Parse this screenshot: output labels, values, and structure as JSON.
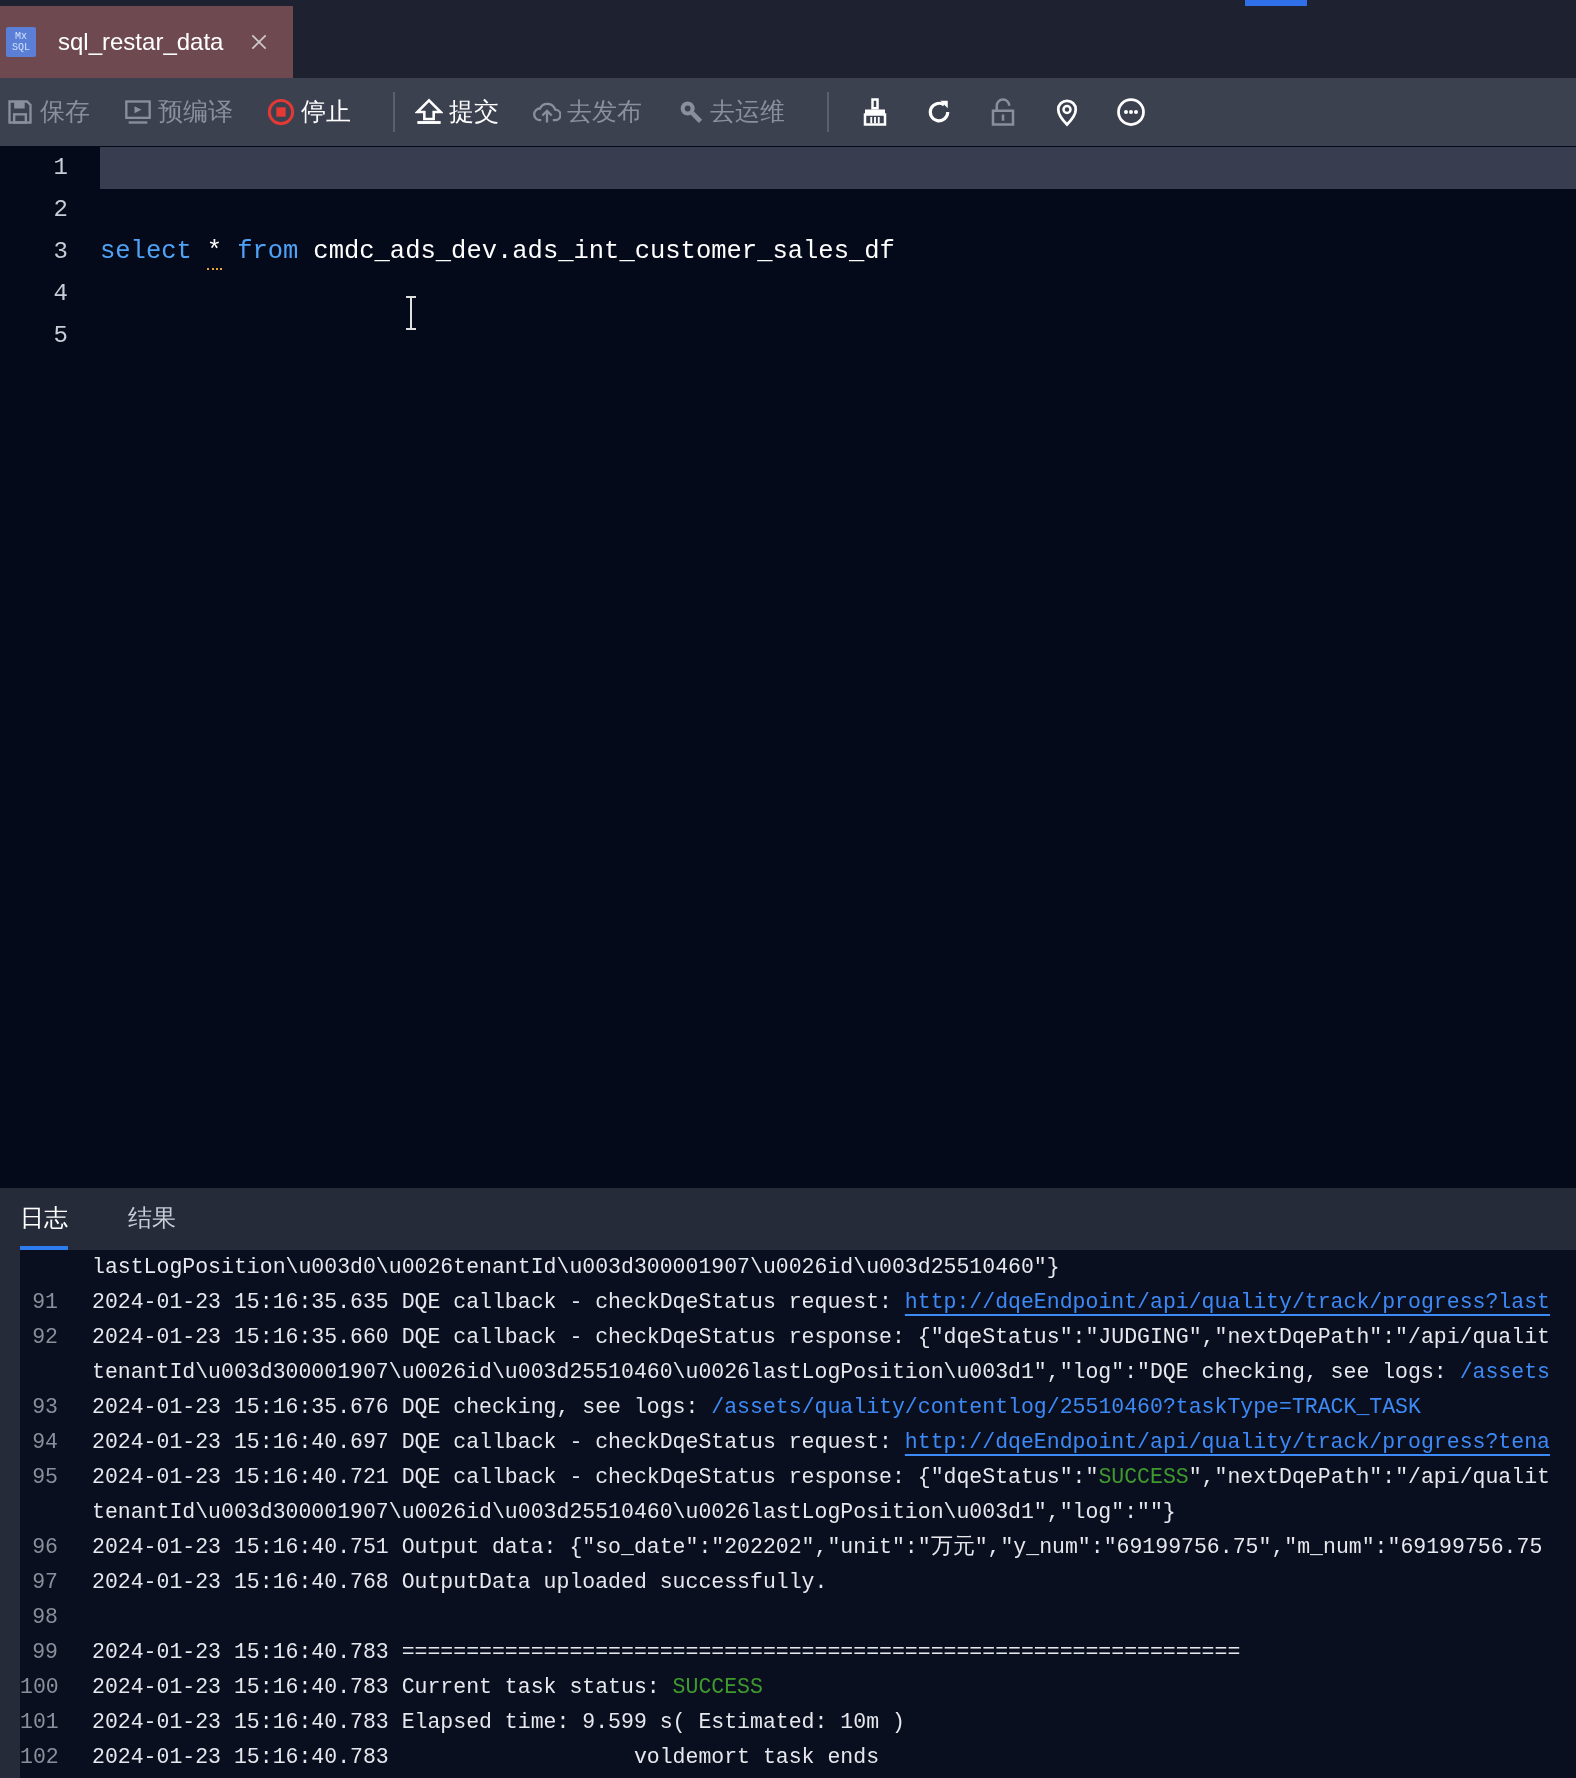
{
  "tab": {
    "icon_text": [
      "Mx",
      "SQL"
    ],
    "title": "sql_restar_data",
    "selected": true
  },
  "toolbar": [
    {
      "kind": "button",
      "label": "保存",
      "disabled": true
    },
    {
      "kind": "button",
      "label": "预编译",
      "disabled": true
    },
    {
      "kind": "button",
      "label": "停止",
      "disabled": false
    },
    {
      "kind": "separator"
    },
    {
      "kind": "button",
      "label": "提交",
      "disabled": false
    },
    {
      "kind": "button",
      "label": "去发布",
      "disabled": true
    },
    {
      "kind": "button",
      "label": "去运维",
      "disabled": true
    },
    {
      "kind": "separator"
    },
    {
      "kind": "icon",
      "disabled": false
    },
    {
      "kind": "icon",
      "disabled": false
    },
    {
      "kind": "icon",
      "disabled": true
    },
    {
      "kind": "icon",
      "disabled": false
    },
    {
      "kind": "icon",
      "disabled": false
    }
  ],
  "editor": {
    "lines": [
      {
        "number": "1",
        "current": true
      },
      {
        "number": "2",
        "current": false
      },
      {
        "number": "3",
        "current": false,
        "tokens": [
          {
            "kind": "keyword",
            "text": "select"
          },
          {
            "kind": "warning",
            "text": "*"
          },
          {
            "kind": "keyword",
            "text": "from"
          },
          {
            "kind": "plain",
            "text": "cmdc_ads_dev.ads_int_customer_sales_df"
          }
        ]
      },
      {
        "number": "4",
        "current": false
      },
      {
        "number": "5",
        "current": false
      }
    ]
  },
  "bottom_tabs": [
    {
      "label": "日志",
      "selected": true
    },
    {
      "label": "结果",
      "selected": false
    }
  ],
  "log": [
    {
      "segments": [
        {
          "kind": "text",
          "text": "lastLogPosition\\u003d0\\u0026tenantId\\u003d300001907\\u0026id\\u003d25510460\"}"
        }
      ]
    },
    {
      "number": "91",
      "segments": [
        {
          "kind": "text",
          "text": "2024-01-23 15:16:35.635 DQE callback - checkDqeStatus request: "
        },
        {
          "kind": "link",
          "text": "http://dqeEndpoint/api/quality/track/progress?last"
        }
      ]
    },
    {
      "number": "92",
      "segments": [
        {
          "kind": "text",
          "text": "2024-01-23 15:16:35.660 DQE callback - checkDqeStatus response: {\"dqeStatus\":\"JUDGING\",\"nextDqePath\":\"/api/qualit"
        }
      ]
    },
    {
      "segments": [
        {
          "kind": "text",
          "text": "tenantId\\u003d300001907\\u0026id\\u003d25510460\\u0026lastLogPosition\\u003d1\",\"log\":\"DQE checking, see logs: "
        },
        {
          "kind": "path",
          "text": "/assets"
        }
      ]
    },
    {
      "number": "93",
      "segments": [
        {
          "kind": "text",
          "text": "2024-01-23 15:16:35.676 DQE checking, see logs: "
        },
        {
          "kind": "path",
          "text": "/assets/quality/contentlog/25510460?taskType=TRACK_TASK"
        }
      ]
    },
    {
      "number": "94",
      "segments": [
        {
          "kind": "text",
          "text": "2024-01-23 15:16:40.697 DQE callback - checkDqeStatus request: "
        },
        {
          "kind": "link",
          "text": "http://dqeEndpoint/api/quality/track/progress?tena"
        }
      ]
    },
    {
      "number": "95",
      "segments": [
        {
          "kind": "text",
          "text": "2024-01-23 15:16:40.721 DQE callback - checkDqeStatus response: {\"dqeStatus\":\""
        },
        {
          "kind": "success",
          "text": "SUCCESS"
        },
        {
          "kind": "text",
          "text": "\",\"nextDqePath\":\"/api/qualit"
        }
      ]
    },
    {
      "segments": [
        {
          "kind": "text",
          "text": "tenantId\\u003d300001907\\u0026id\\u003d25510460\\u0026lastLogPosition\\u003d1\",\"log\":\"\"}"
        }
      ]
    },
    {
      "number": "96",
      "segments": [
        {
          "kind": "text",
          "text": "2024-01-23 15:16:40.751 Output data: {\"so_date\":\"202202\",\"unit\":\"万元\",\"y_num\":\"69199756.75\",\"m_num\":\"69199756.75"
        }
      ]
    },
    {
      "number": "97",
      "segments": [
        {
          "kind": "text",
          "text": "2024-01-23 15:16:40.768 OutputData uploaded successfully."
        }
      ]
    },
    {
      "number": "98"
    },
    {
      "number": "99",
      "segments": [
        {
          "kind": "text",
          "text": "2024-01-23 15:16:40.783 ================================================================="
        }
      ]
    },
    {
      "number": "100",
      "segments": [
        {
          "kind": "text",
          "text": "2024-01-23 15:16:40.783 Current task status: "
        },
        {
          "kind": "success",
          "text": "SUCCESS"
        }
      ]
    },
    {
      "number": "101",
      "segments": [
        {
          "kind": "text",
          "text": "2024-01-23 15:16:40.783 Elapsed time: 9.599 s( Estimated: 10m )"
        }
      ]
    },
    {
      "number": "102",
      "segments": [
        {
          "kind": "text",
          "text": "2024-01-23 15:16:40.783                   voldemort task ends"
        }
      ]
    }
  ]
}
